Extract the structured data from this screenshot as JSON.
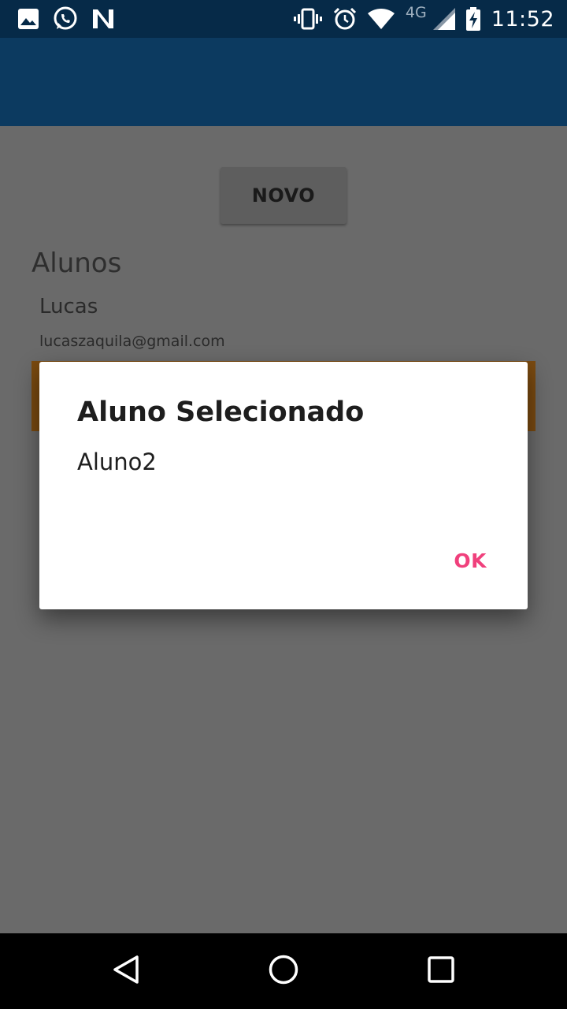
{
  "status_bar": {
    "time": "11:52",
    "network": "4G",
    "left_icons": [
      "image-icon",
      "whatsapp-icon",
      "n-notification-icon"
    ],
    "right_icons": [
      "vibrate-icon",
      "alarm-icon",
      "wifi-icon",
      "signal-icon",
      "battery-charging-icon"
    ]
  },
  "main": {
    "new_button_label": "NOVO",
    "list_title": "Alunos",
    "students": [
      {
        "name": "Lucas",
        "email": "lucaszaquila@gmail.com"
      }
    ]
  },
  "dialog": {
    "title": "Aluno Selecionado",
    "message": "Aluno2",
    "ok_label": "OK"
  },
  "navigation": {
    "icons": [
      "back-icon",
      "home-icon",
      "recents-icon"
    ]
  },
  "colors": {
    "status_bar": "#062a48",
    "app_bar": "#0c3a60",
    "scrim_background": "#6a6a6a",
    "selected_row": "#7a4a10",
    "dialog_accent": "#f0407c"
  }
}
